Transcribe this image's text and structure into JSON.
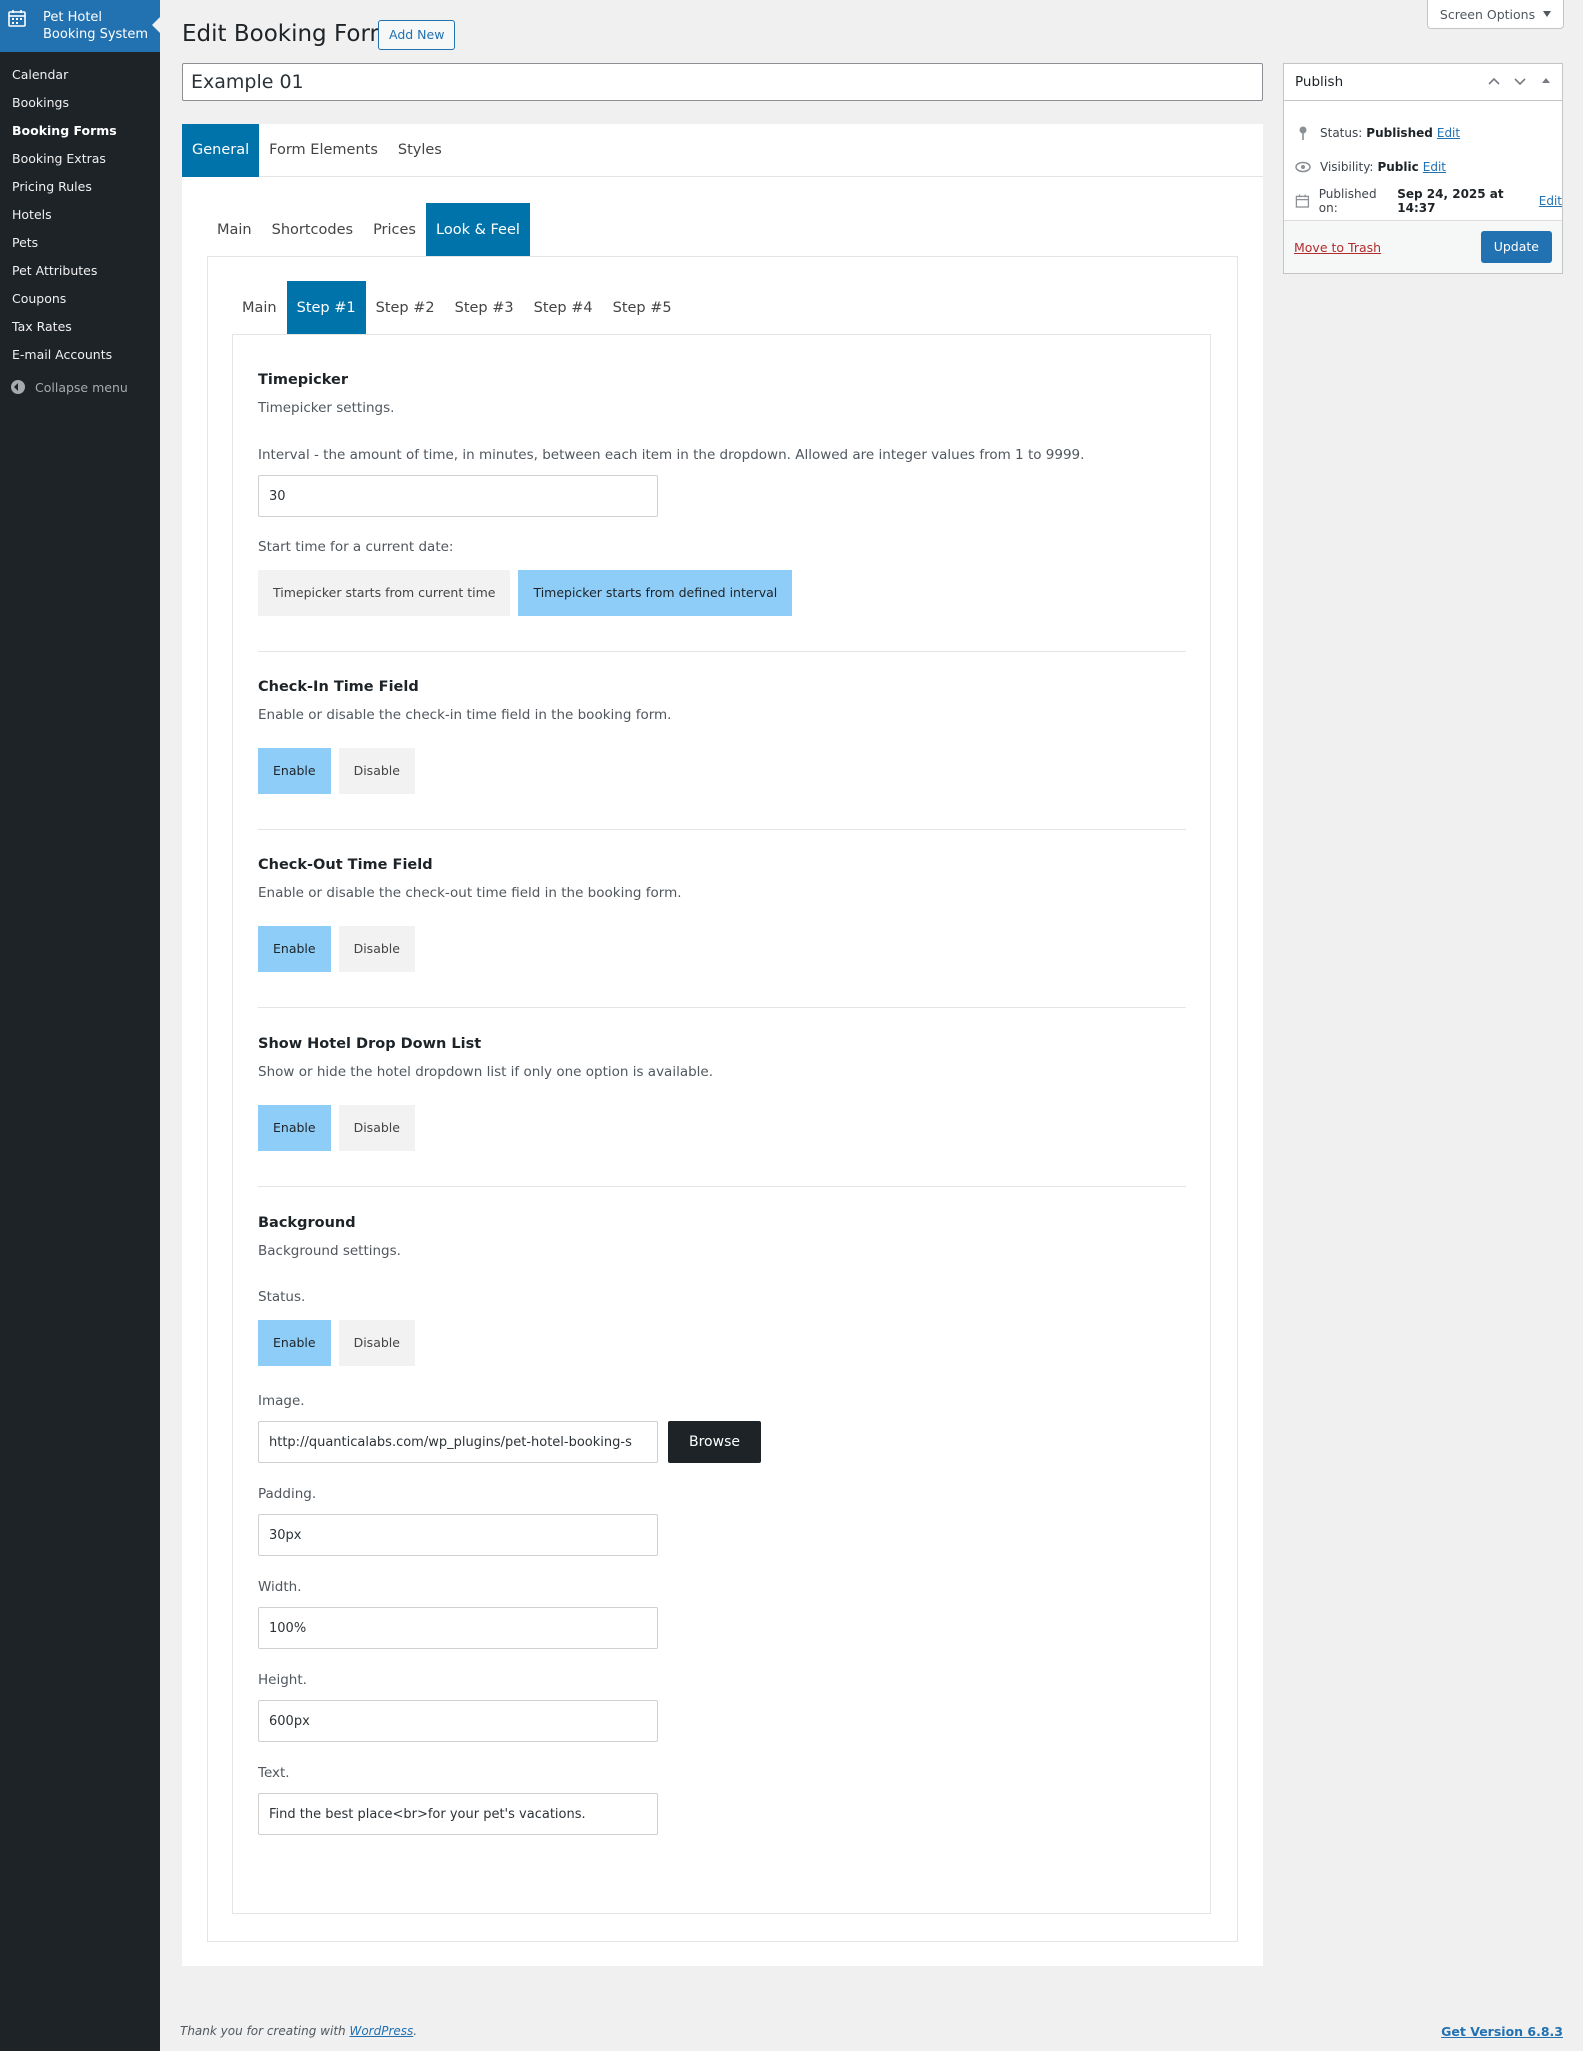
{
  "sidebar": {
    "brand": "Pet Hotel Booking System",
    "items": [
      {
        "label": "Calendar"
      },
      {
        "label": "Bookings"
      },
      {
        "label": "Booking Forms"
      },
      {
        "label": "Booking Extras"
      },
      {
        "label": "Pricing Rules"
      },
      {
        "label": "Hotels"
      },
      {
        "label": "Pets"
      },
      {
        "label": "Pet Attributes"
      },
      {
        "label": "Coupons"
      },
      {
        "label": "Tax Rates"
      },
      {
        "label": "E-mail Accounts"
      }
    ],
    "current": "Booking Forms",
    "collapse": "Collapse menu"
  },
  "header": {
    "title": "Edit Booking Form",
    "add_new": "Add New",
    "screen_options": "Screen Options",
    "form_title": "Example 01"
  },
  "tabs_top": [
    "General",
    "Form Elements",
    "Styles"
  ],
  "tabs_mid": [
    "Main",
    "Shortcodes",
    "Prices",
    "Look & Feel"
  ],
  "tabs_inner": [
    "Main",
    "Step #1",
    "Step #2",
    "Step #3",
    "Step #4",
    "Step #5"
  ],
  "timepicker": {
    "title": "Timepicker",
    "desc": "Timepicker settings.",
    "interval_label": "Interval - the amount of time, in minutes, between each item in the dropdown. Allowed are integer values from 1 to 9999.",
    "interval_value": "30",
    "start_label": "Start time for a current date:",
    "opt_current": "Timepicker starts from current time",
    "opt_defined": "Timepicker starts from defined interval",
    "selected": "defined"
  },
  "checkin": {
    "title": "Check-In Time Field",
    "desc": "Enable or disable the check-in time field in the booking form.",
    "enable": "Enable",
    "disable": "Disable",
    "selected": "enable"
  },
  "checkout": {
    "title": "Check-Out Time Field",
    "desc": "Enable or disable the check-out time field in the booking form.",
    "enable": "Enable",
    "disable": "Disable",
    "selected": "enable"
  },
  "hotel_dropdown": {
    "title": "Show Hotel Drop Down List",
    "desc": "Show or hide the hotel dropdown list if only one option is available.",
    "enable": "Enable",
    "disable": "Disable",
    "selected": "enable"
  },
  "background": {
    "title": "Background",
    "desc": "Background settings.",
    "status_label": "Status.",
    "enable": "Enable",
    "disable": "Disable",
    "selected": "enable",
    "image_label": "Image.",
    "image_value": "http://quanticalabs.com/wp_plugins/pet-hotel-booking-s",
    "browse": "Browse",
    "padding_label": "Padding.",
    "padding_value": "30px",
    "width_label": "Width.",
    "width_value": "100%",
    "height_label": "Height.",
    "height_value": "600px",
    "text_label": "Text.",
    "text_value": "Find the best place<br>for your pet's vacations."
  },
  "publish": {
    "title": "Publish",
    "status_label": "Status:",
    "status_value": "Published",
    "visibility_label": "Visibility:",
    "visibility_value": "Public",
    "published_label": "Published on:",
    "published_value": "Sep 24, 2025 at 14:37",
    "edit": "Edit",
    "trash": "Move to Trash",
    "update": "Update"
  },
  "footer": {
    "thanks_prefix": "Thank you for creating with ",
    "wp_link": "WordPress",
    "thanks_suffix": ".",
    "version": "Get Version 6.8.3"
  },
  "colors": {
    "sidebar_bg": "#1d2327",
    "brand_bg": "#2271b1",
    "tab_active": "#0073aa",
    "toggle_on": "#8ecdf8",
    "toggle_off": "#f2f2f2"
  }
}
